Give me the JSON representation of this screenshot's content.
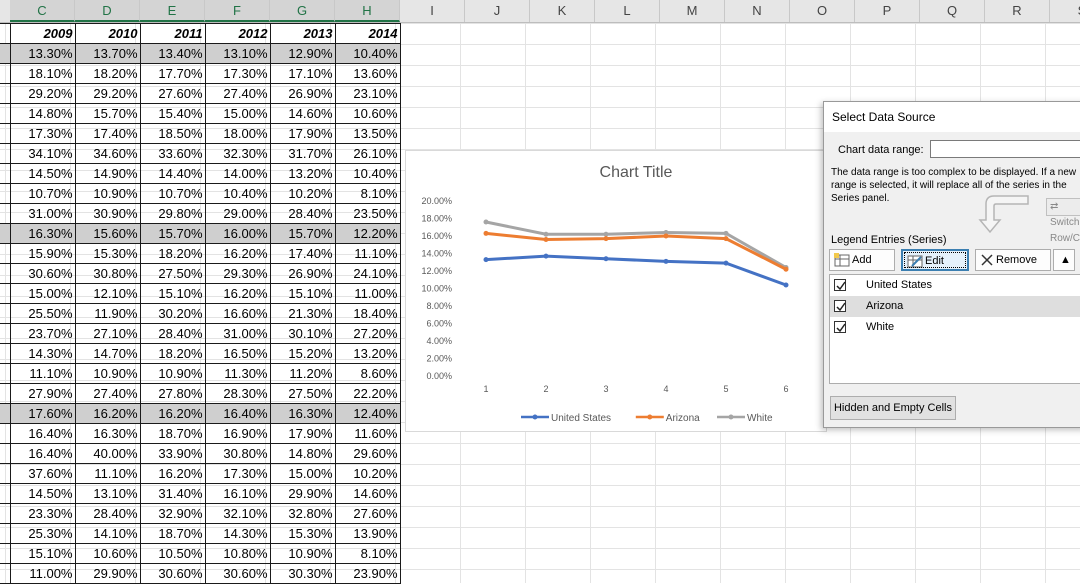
{
  "columns": [
    "C",
    "D",
    "E",
    "F",
    "G",
    "H",
    "I",
    "J",
    "K",
    "L",
    "M",
    "N",
    "O",
    "P",
    "Q",
    "R",
    "S"
  ],
  "table": {
    "headers": [
      "2009",
      "2010",
      "2011",
      "2012",
      "2013",
      "2014"
    ],
    "rows": [
      {
        "gray": true,
        "cells": [
          "13.30%",
          "13.70%",
          "13.40%",
          "13.10%",
          "12.90%",
          "10.40%"
        ]
      },
      {
        "gray": false,
        "cells": [
          "18.10%",
          "18.20%",
          "17.70%",
          "17.30%",
          "17.10%",
          "13.60%"
        ]
      },
      {
        "gray": false,
        "cells": [
          "29.20%",
          "29.20%",
          "27.60%",
          "27.40%",
          "26.90%",
          "23.10%"
        ]
      },
      {
        "gray": false,
        "cells": [
          "14.80%",
          "15.70%",
          "15.40%",
          "15.00%",
          "14.60%",
          "10.60%"
        ]
      },
      {
        "gray": false,
        "cells": [
          "17.30%",
          "17.40%",
          "18.50%",
          "18.00%",
          "17.90%",
          "13.50%"
        ]
      },
      {
        "gray": false,
        "cells": [
          "34.10%",
          "34.60%",
          "33.60%",
          "32.30%",
          "31.70%",
          "26.10%"
        ]
      },
      {
        "gray": false,
        "cells": [
          "14.50%",
          "14.90%",
          "14.40%",
          "14.00%",
          "13.20%",
          "10.40%"
        ]
      },
      {
        "gray": false,
        "cells": [
          "10.70%",
          "10.90%",
          "10.70%",
          "10.40%",
          "10.20%",
          "8.10%"
        ]
      },
      {
        "gray": false,
        "cells": [
          "31.00%",
          "30.90%",
          "29.80%",
          "29.00%",
          "28.40%",
          "23.50%"
        ]
      },
      {
        "gray": true,
        "cells": [
          "16.30%",
          "15.60%",
          "15.70%",
          "16.00%",
          "15.70%",
          "12.20%"
        ]
      },
      {
        "gray": false,
        "cells": [
          "15.90%",
          "15.30%",
          "18.20%",
          "16.20%",
          "17.40%",
          "11.10%"
        ]
      },
      {
        "gray": false,
        "cells": [
          "30.60%",
          "30.80%",
          "27.50%",
          "29.30%",
          "26.90%",
          "24.10%"
        ]
      },
      {
        "gray": false,
        "cells": [
          "15.00%",
          "12.10%",
          "15.10%",
          "16.20%",
          "15.10%",
          "11.00%"
        ]
      },
      {
        "gray": false,
        "cells": [
          "25.50%",
          "11.90%",
          "30.20%",
          "16.60%",
          "21.30%",
          "18.40%"
        ]
      },
      {
        "gray": false,
        "cells": [
          "23.70%",
          "27.10%",
          "28.40%",
          "31.00%",
          "30.10%",
          "27.20%"
        ]
      },
      {
        "gray": false,
        "cells": [
          "14.30%",
          "14.70%",
          "18.20%",
          "16.50%",
          "15.20%",
          "13.20%"
        ]
      },
      {
        "gray": false,
        "cells": [
          "11.10%",
          "10.90%",
          "10.90%",
          "11.30%",
          "11.20%",
          "8.60%"
        ]
      },
      {
        "gray": false,
        "cells": [
          "27.90%",
          "27.40%",
          "27.80%",
          "28.30%",
          "27.50%",
          "22.20%"
        ]
      },
      {
        "gray": true,
        "cells": [
          "17.60%",
          "16.20%",
          "16.20%",
          "16.40%",
          "16.30%",
          "12.40%"
        ]
      },
      {
        "gray": false,
        "cells": [
          "16.40%",
          "16.30%",
          "18.70%",
          "16.90%",
          "17.90%",
          "11.60%"
        ]
      },
      {
        "gray": false,
        "cells": [
          "16.40%",
          "40.00%",
          "33.90%",
          "30.80%",
          "14.80%",
          "29.60%"
        ]
      },
      {
        "gray": false,
        "cells": [
          "37.60%",
          "11.10%",
          "16.20%",
          "17.30%",
          "15.00%",
          "10.20%"
        ]
      },
      {
        "gray": false,
        "cells": [
          "14.50%",
          "13.10%",
          "31.40%",
          "16.10%",
          "29.90%",
          "14.60%"
        ]
      },
      {
        "gray": false,
        "cells": [
          "23.30%",
          "28.40%",
          "32.90%",
          "32.10%",
          "32.80%",
          "27.60%"
        ]
      },
      {
        "gray": false,
        "cells": [
          "25.30%",
          "14.10%",
          "18.70%",
          "14.30%",
          "15.30%",
          "13.90%"
        ]
      },
      {
        "gray": false,
        "cells": [
          "15.10%",
          "10.60%",
          "10.50%",
          "10.80%",
          "10.90%",
          "8.10%"
        ]
      },
      {
        "gray": false,
        "cells": [
          "11.00%",
          "29.90%",
          "30.60%",
          "30.60%",
          "30.30%",
          "23.90%"
        ]
      }
    ]
  },
  "chart_data": {
    "type": "line",
    "title": "Chart Title",
    "x": [
      "1",
      "2",
      "3",
      "4",
      "5",
      "6"
    ],
    "ylim": [
      0,
      20
    ],
    "yticks": [
      "0.00%",
      "2.00%",
      "4.00%",
      "6.00%",
      "8.00%",
      "10.00%",
      "12.00%",
      "14.00%",
      "16.00%",
      "18.00%",
      "20.00%"
    ],
    "series": [
      {
        "name": "United States",
        "color": "#4472c4",
        "values": [
          13.3,
          13.7,
          13.4,
          13.1,
          12.9,
          10.4
        ]
      },
      {
        "name": "Arizona",
        "color": "#ed7d31",
        "values": [
          16.3,
          15.6,
          15.7,
          16.0,
          15.7,
          12.2
        ]
      },
      {
        "name": "White",
        "color": "#a5a5a5",
        "values": [
          17.6,
          16.2,
          16.2,
          16.4,
          16.3,
          12.4
        ]
      }
    ],
    "grid": false,
    "legend": "bottom"
  },
  "dialog": {
    "title": "Select Data Source",
    "range_label": "Chart data range:",
    "range_value": "",
    "message": "The data range is too complex to be displayed. If a new range is selected, it will replace all of the series in the Series panel.",
    "switch_label": "Switch Row/Column",
    "legend_entries_label": "Legend Entries (Series)",
    "add_label": "Add",
    "edit_label": "Edit",
    "remove_label": "Remove",
    "series": [
      {
        "name": "United States",
        "checked": true,
        "selected": false
      },
      {
        "name": "Arizona",
        "checked": true,
        "selected": true
      },
      {
        "name": "White",
        "checked": true,
        "selected": false
      }
    ],
    "hidden_cells_label": "Hidden and Empty Cells"
  }
}
